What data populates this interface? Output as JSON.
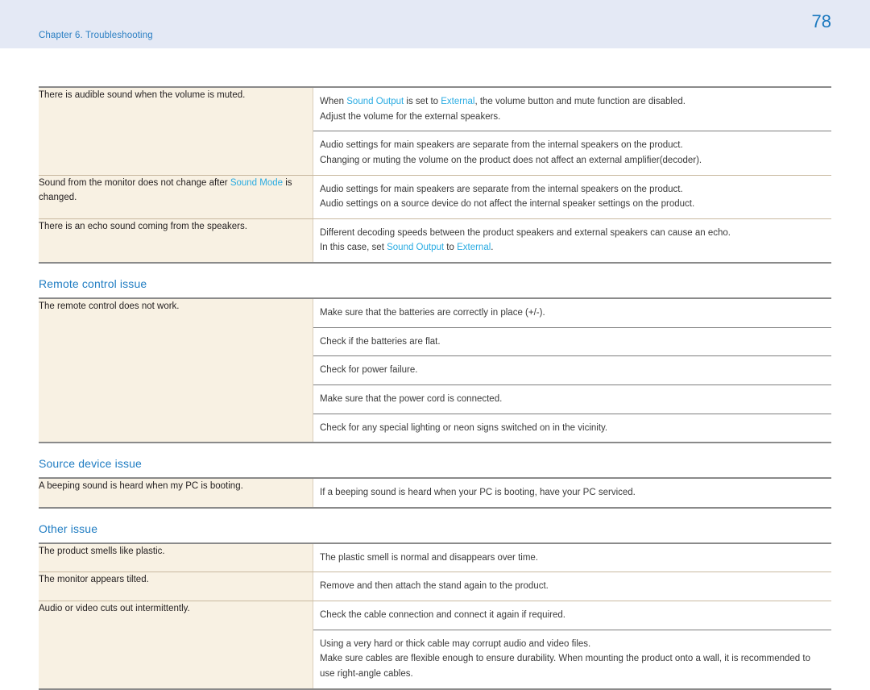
{
  "header": {
    "chapter": "Chapter 6. Troubleshooting",
    "page_number": "78",
    "band_color": "#e4e9f5",
    "chapter_color": "#2b7fc3",
    "page_number_color": "#1a78bf"
  },
  "colors": {
    "heading": "#1f7cc2",
    "highlight": "#29abe2",
    "symptom_bg": "#f8f1e3",
    "rule_strong": "#8a8a8a",
    "rule_light": "#7d7d7d"
  },
  "sections": [
    {
      "heading": null,
      "rows": [
        {
          "symptom": [
            {
              "t": "There is audible sound when the volume is muted.",
              "hl": false
            }
          ],
          "groups": [
            {
              "lines": [
                [
                  {
                    "t": "When ",
                    "hl": false
                  },
                  {
                    "t": "Sound Output",
                    "hl": true
                  },
                  {
                    "t": " is set to ",
                    "hl": false
                  },
                  {
                    "t": "External",
                    "hl": true
                  },
                  {
                    "t": ", the volume button and mute function are disabled.",
                    "hl": false
                  }
                ],
                [
                  {
                    "t": "Adjust the volume for the external speakers.",
                    "hl": false
                  }
                ]
              ]
            },
            {
              "lines": [
                [
                  {
                    "t": "Audio settings for main speakers are separate from the internal speakers on the product.",
                    "hl": false
                  }
                ],
                [
                  {
                    "t": "Changing or muting the volume on the product does not affect an external amplifier(decoder).",
                    "hl": false
                  }
                ]
              ]
            }
          ]
        },
        {
          "symptom": [
            {
              "t": "Sound from the monitor does not change after ",
              "hl": false
            },
            {
              "t": "Sound Mode",
              "hl": true
            },
            {
              "t": " is changed.",
              "hl": false
            }
          ],
          "groups": [
            {
              "lines": [
                [
                  {
                    "t": "Audio settings for main speakers are separate from the internal speakers on the product.",
                    "hl": false
                  }
                ],
                [
                  {
                    "t": "Audio settings on a source device do not affect the internal speaker settings on the product.",
                    "hl": false
                  }
                ]
              ]
            }
          ]
        },
        {
          "symptom": [
            {
              "t": "There is an echo sound coming from the speakers.",
              "hl": false
            }
          ],
          "groups": [
            {
              "lines": [
                [
                  {
                    "t": "Different decoding speeds between the product speakers and external speakers can cause an echo.",
                    "hl": false
                  }
                ],
                [
                  {
                    "t": "In this case, set ",
                    "hl": false
                  },
                  {
                    "t": "Sound Output",
                    "hl": true
                  },
                  {
                    "t": " to ",
                    "hl": false
                  },
                  {
                    "t": "External",
                    "hl": true
                  },
                  {
                    "t": ".",
                    "hl": false
                  }
                ]
              ]
            }
          ]
        }
      ]
    },
    {
      "heading": "Remote control issue",
      "rows": [
        {
          "symptom": [
            {
              "t": "The remote control does not work.",
              "hl": false
            }
          ],
          "groups": [
            {
              "lines": [
                [
                  {
                    "t": "Make sure that the batteries are correctly in place (+/-).",
                    "hl": false
                  }
                ]
              ]
            },
            {
              "lines": [
                [
                  {
                    "t": "Check if the batteries are flat.",
                    "hl": false
                  }
                ]
              ]
            },
            {
              "lines": [
                [
                  {
                    "t": "Check for power failure.",
                    "hl": false
                  }
                ]
              ]
            },
            {
              "lines": [
                [
                  {
                    "t": "Make sure that the power cord is connected.",
                    "hl": false
                  }
                ]
              ]
            },
            {
              "lines": [
                [
                  {
                    "t": "Check for any special lighting or neon signs switched on in the vicinity.",
                    "hl": false
                  }
                ]
              ]
            }
          ]
        }
      ]
    },
    {
      "heading": "Source device issue",
      "rows": [
        {
          "symptom": [
            {
              "t": "A beeping sound is heard when my PC is booting.",
              "hl": false
            }
          ],
          "groups": [
            {
              "lines": [
                [
                  {
                    "t": "If a beeping sound is heard when your PC is booting, have your PC serviced.",
                    "hl": false
                  }
                ]
              ]
            }
          ]
        }
      ]
    },
    {
      "heading": "Other issue",
      "rows": [
        {
          "symptom": [
            {
              "t": "The product smells like plastic.",
              "hl": false
            }
          ],
          "groups": [
            {
              "lines": [
                [
                  {
                    "t": "The plastic smell is normal and disappears over time.",
                    "hl": false
                  }
                ]
              ]
            }
          ]
        },
        {
          "symptom": [
            {
              "t": "The monitor appears tilted.",
              "hl": false
            }
          ],
          "groups": [
            {
              "lines": [
                [
                  {
                    "t": "Remove and then attach the stand again to the product.",
                    "hl": false
                  }
                ]
              ]
            }
          ]
        },
        {
          "symptom": [
            {
              "t": "Audio or video cuts out intermittently.",
              "hl": false
            }
          ],
          "groups": [
            {
              "lines": [
                [
                  {
                    "t": "Check the cable connection and connect it again if required.",
                    "hl": false
                  }
                ]
              ]
            },
            {
              "lines": [
                [
                  {
                    "t": "Using a very hard or thick cable may corrupt audio and video files.",
                    "hl": false
                  }
                ],
                [
                  {
                    "t": "Make sure cables are flexible enough to ensure durability. When mounting the product onto a wall, it is recommended to use right-angle cables.",
                    "hl": false
                  }
                ]
              ]
            }
          ]
        }
      ]
    }
  ]
}
